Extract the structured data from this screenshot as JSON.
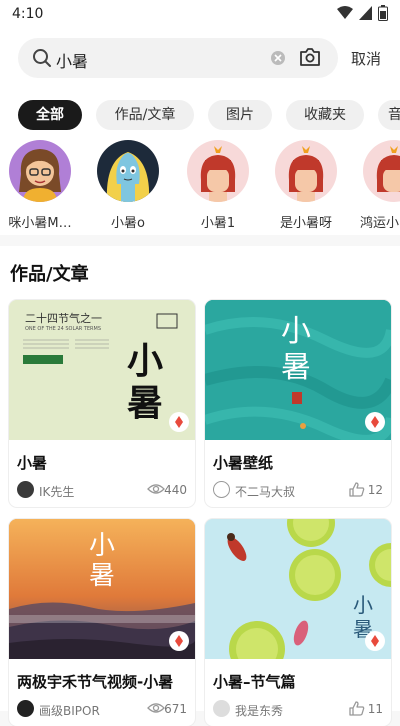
{
  "status": {
    "time": "4:10"
  },
  "search": {
    "query": "小暑",
    "cancel_label": "取消"
  },
  "filters": [
    "全部",
    "作品/文章",
    "图片",
    "收藏夹",
    "音"
  ],
  "users": [
    "咪小暑M…",
    "小暑o",
    "小暑1",
    "是小暑呀",
    "鸿运小"
  ],
  "section": {
    "title": "作品/文章"
  },
  "cards": [
    {
      "title": "小暑",
      "author": "IK先生",
      "stat": "440",
      "stat_icon": "eye-icon",
      "cover_texts": {
        "top": "二十四节气之一",
        "sub": "ONE OF THE 24 SOLAR TERMS",
        "big": "小暑"
      }
    },
    {
      "title": "小暑壁纸",
      "author": "不二马大叔",
      "stat": "12",
      "stat_icon": "like-icon",
      "cover_texts": {
        "big": "小暑"
      }
    },
    {
      "title": "两极宇禾节气视频-小暑",
      "author": "画级BIPOR",
      "stat": "671",
      "stat_icon": "eye-icon",
      "cover_texts": {
        "big": "小暑"
      }
    },
    {
      "title": "小暑–节气篇",
      "author": "我是东秀",
      "stat": "11",
      "stat_icon": "like-icon",
      "cover_texts": {
        "big": "小暑"
      }
    }
  ],
  "colors": {
    "chip_active": "#1a1a1a",
    "badge_red": "#e84a3c"
  }
}
